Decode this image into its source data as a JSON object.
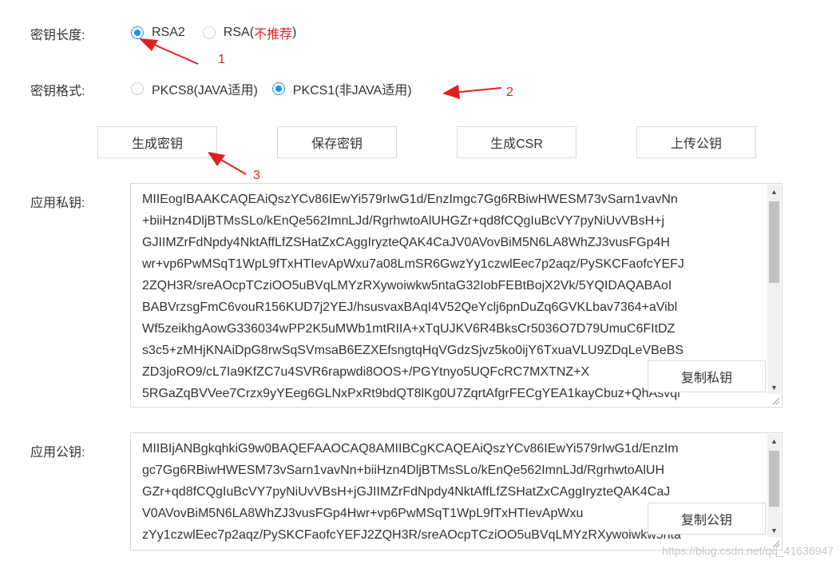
{
  "key_length": {
    "label": "密钥长度:",
    "options": [
      {
        "label": "RSA2",
        "suffix": "",
        "selected": true
      },
      {
        "label": "RSA(",
        "suffix": "不推荐",
        "close": ")",
        "selected": false
      }
    ]
  },
  "key_format": {
    "label": "密钥格式:",
    "options": [
      {
        "label": "PKCS8(JAVA适用)",
        "selected": false
      },
      {
        "label": "PKCS1(非JAVA适用)",
        "selected": true
      }
    ]
  },
  "buttons": {
    "generate": "生成密钥",
    "save": "保存密钥",
    "csr": "生成CSR",
    "upload": "上传公钥"
  },
  "private_key": {
    "label": "应用私钥:",
    "lines": [
      "MIIEogIBAAKCAQEAiQszYCv86IEwYi579rIwG1d/EnzImgc7Gg6RBiwHWESM73vSarn1vavNn",
      "+biiHzn4DljBTMsSLo/kEnQe562ImnLJd/RgrhwtoAlUHGZr+qd8fCQgIuBcVY7pyNiUvVBsH+j",
      "GJIIMZrFdNpdy4NktAffLfZSHatZxCAggIryzteQAK4CaJV0AVovBiM5N6LA8WhZJ3vusFGp4H",
      "wr+vp6PwMSqT1WpL9fTxHTIevApWxu7a08LmSR6GwzYy1czwlEec7p2aqz/PySKCFaofcYEFJ",
      "2ZQH3R/sreAOcpTCziOO5uBVqLMYzRXywoiwkw5ntaG32IobFEBtBojX2Vk/5YQIDAQABAoI",
      "BABVrzsgFmC6vouR156KUD7j2YEJ/hsusvaxBAqI4V52QeYclj6pnDuZq6GVKLbav7364+aVibl",
      "Wf5zeikhgAowG336034wPP2K5uMWb1mtRIIA+xTqUJKV6R4BksCr5036O7D79UmuC6FItDZ",
      "s3c5+zMHjKNAiDpG8rwSqSVmsaB6EZXEfsngtqHqVGdzSjvz5ko0ijY6TxuaVLU9ZDqLeVBeBS",
      "ZD3joRO9/cL7Ia9KfZC7u4SVR6rapwdi8OOS+/PGYtnyo5UQFcRC7MXTNZ+X",
      "5RGaZqBVVee7Crzx9yYEeg6GLNxPxRt9bdQT8lKg0U7ZqrtAfgrFECgYEA1kayCbuz+QhAsvqi"
    ],
    "copy_label": "复制私钥"
  },
  "public_key": {
    "label": "应用公钥:",
    "lines": [
      "MIIBIjANBgkqhkiG9w0BAQEFAAOCAQ8AMIIBCgKCAQEAiQszYCv86IEwYi579rIwG1d/EnzIm",
      "gc7Gg6RBiwHWESM73vSarn1vavNn+biiHzn4DljBTMsSLo/kEnQe562ImnLJd/RgrhwtoAlUH",
      "GZr+qd8fCQgIuBcVY7pyNiUvVBsH+jGJIIMZrFdNpdy4NktAffLfZSHatZxCAggIryzteQAK4CaJ",
      "V0AVovBiM5N6LA8WhZJ3vusFGp4Hwr+vp6PwMSqT1WpL9fTxHTIevApWxu",
      "zYy1czwlEec7p2aqz/PySKCFaofcYEFJ2ZQH3R/sreAOcpTCziOO5uBVqLMYzRXywoiwkw5nta"
    ],
    "copy_label": "复制公钥"
  },
  "annotations": [
    "1",
    "2",
    "3"
  ],
  "watermark": "https://blog.csdn.net/qq_41636947",
  "colors": {
    "accent": "#1890ff",
    "warning": "#e02020"
  }
}
